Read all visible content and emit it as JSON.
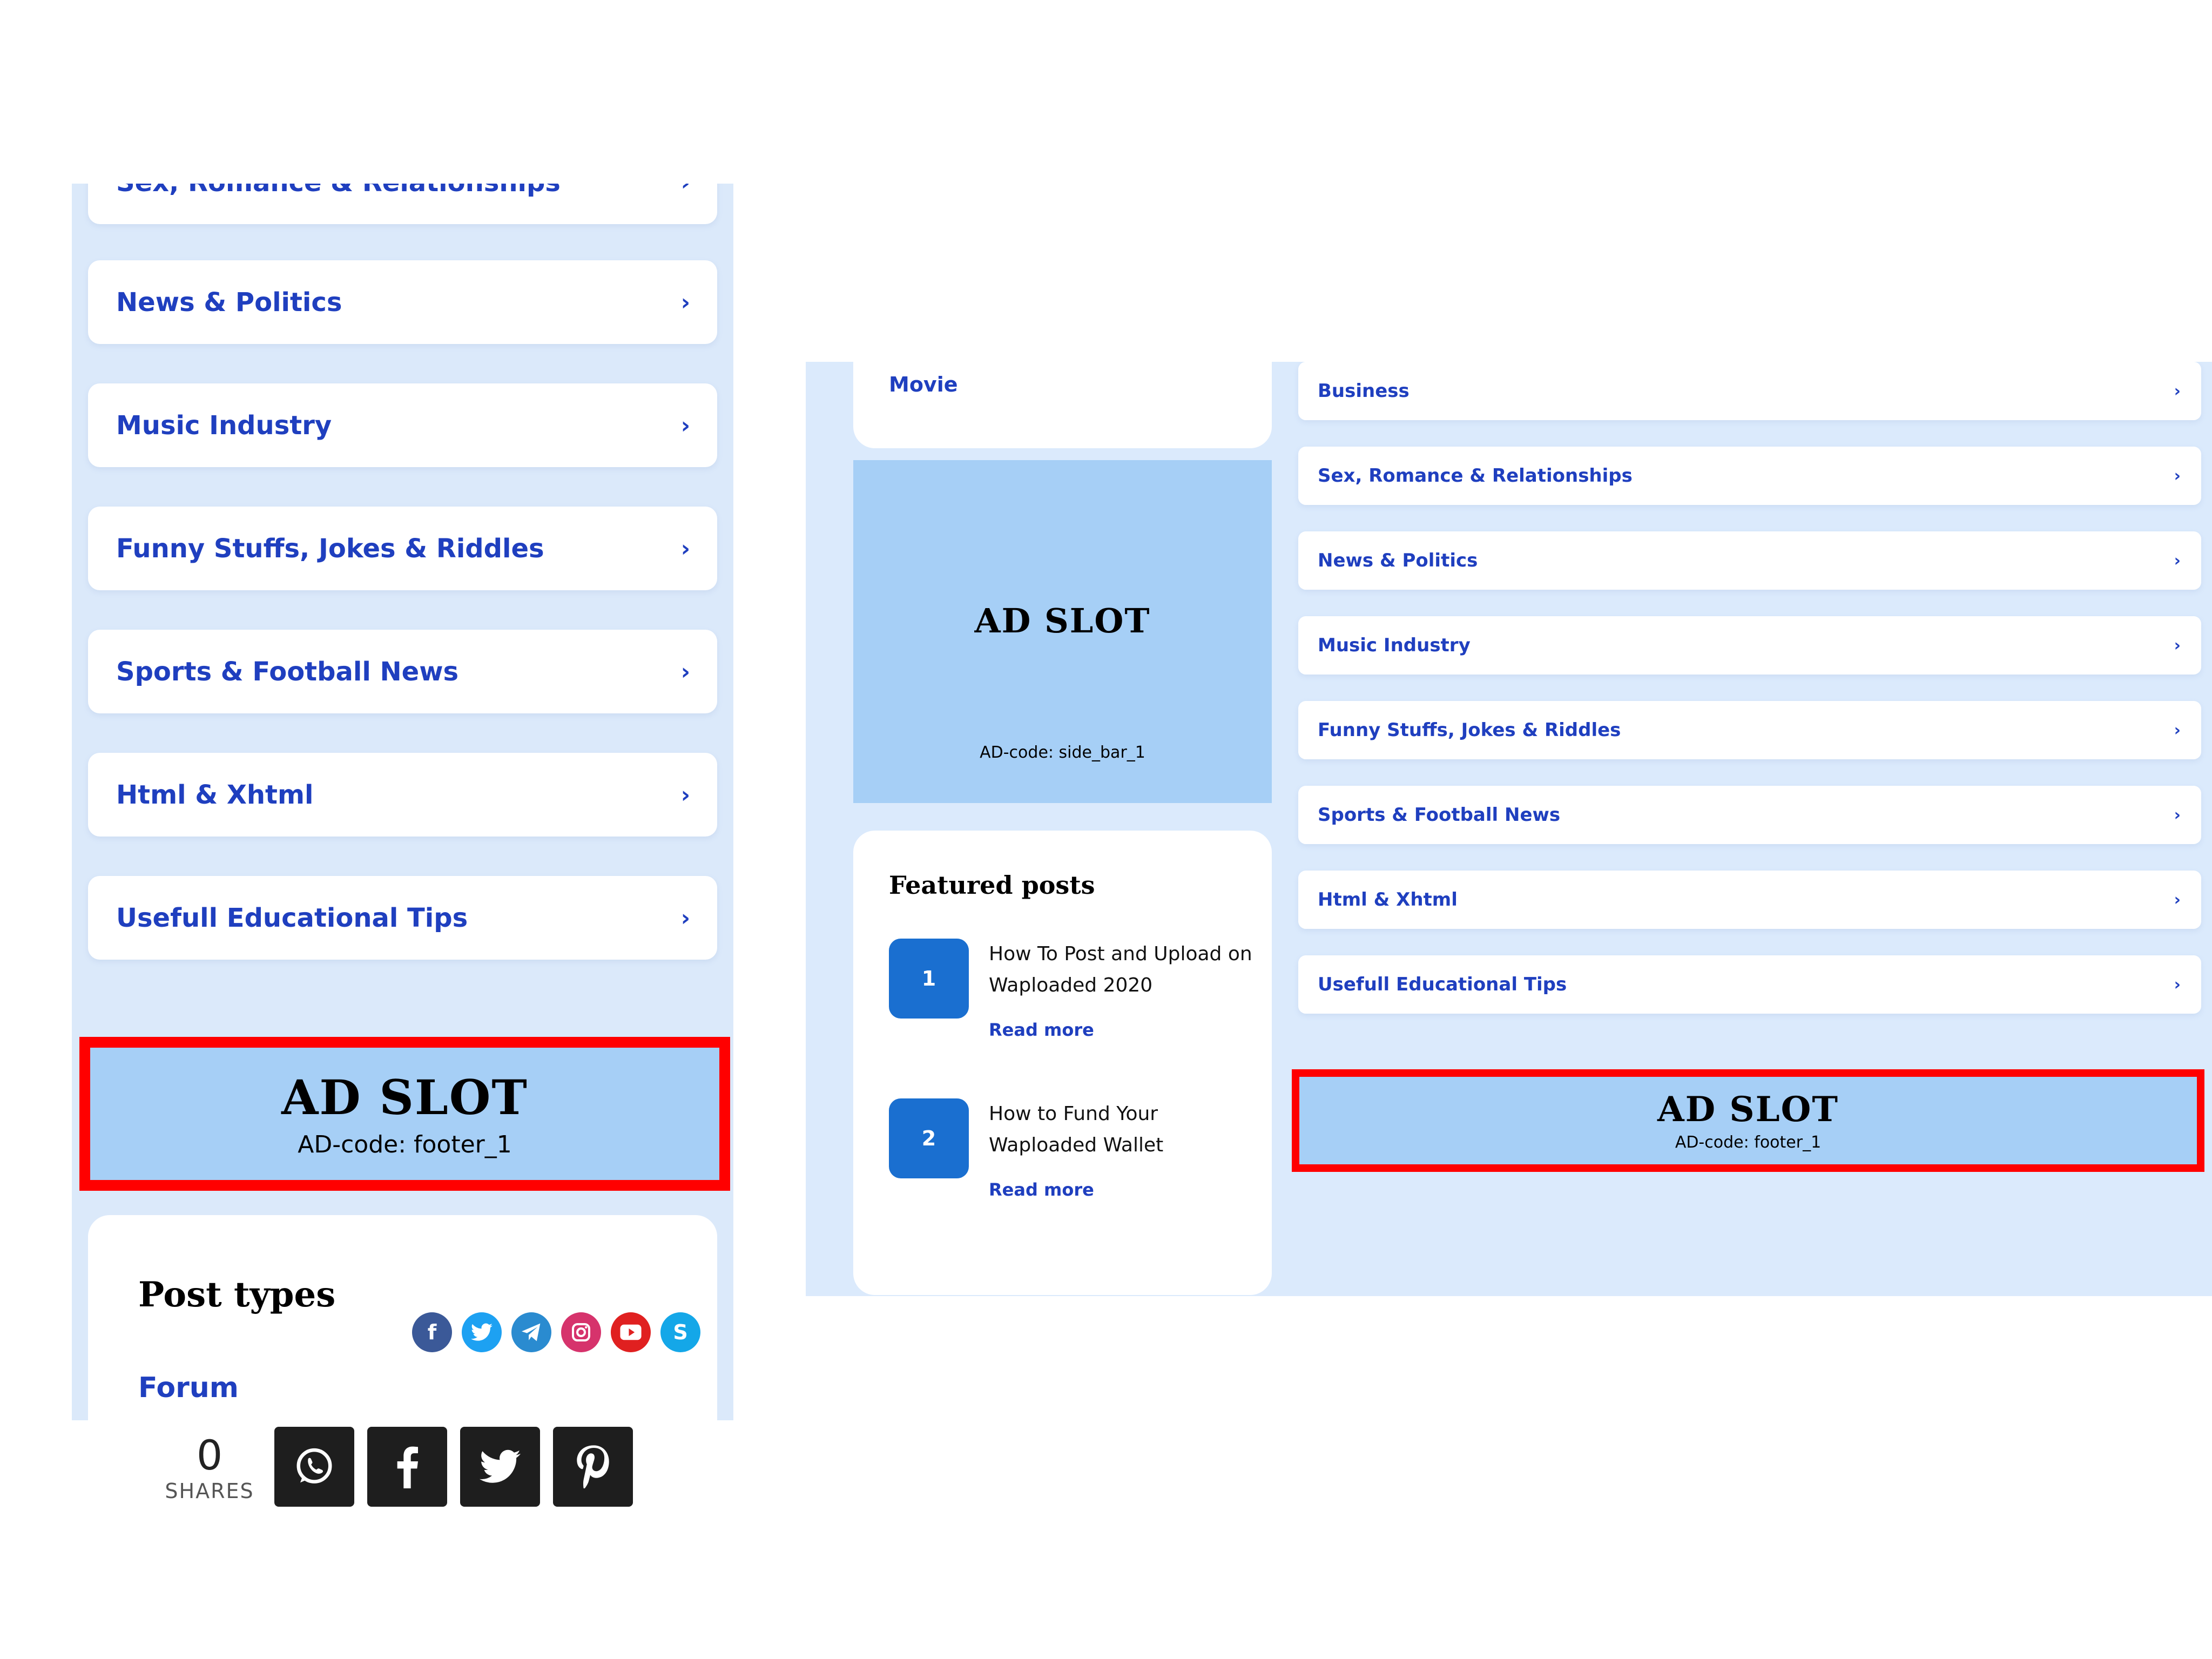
{
  "left": {
    "top_partial_item": "Sex, Romance & Relationships",
    "categories": [
      "News & Politics",
      "Music Industry",
      "Funny Stuffs, Jokes & Riddles",
      "Sports & Football News",
      "Html & Xhtml",
      "Usefull Educational Tips"
    ],
    "chevron": "›",
    "ad_title": "AD SLOT",
    "ad_code": "AD-code: footer_1",
    "post_types_title": "Post types",
    "forum_link": "Forum",
    "social_icons": [
      "facebook-icon",
      "twitter-icon",
      "telegram-icon",
      "instagram-icon",
      "youtube-icon",
      "skype-icon"
    ],
    "share_count": "0",
    "share_label": "SHARES",
    "share_buttons": [
      "whatsapp-icon",
      "facebook-icon",
      "twitter-icon",
      "pinterest-icon"
    ]
  },
  "right": {
    "movie_label": "Movie",
    "side_ad_title": "AD SLOT",
    "side_ad_code": "AD-code: side_bar_1",
    "featured_title": "Featured posts",
    "featured_posts": [
      {
        "num": "1",
        "title": "How To Post and Upload on Waploaded 2020",
        "more": "Read more"
      },
      {
        "num": "2",
        "title": "How to Fund Your Waploaded Wallet",
        "more": "Read more"
      }
    ],
    "categories": [
      "Business",
      "Sex, Romance & Relationships",
      "News & Politics",
      "Music Industry",
      "Funny Stuffs, Jokes & Riddles",
      "Sports & Football News",
      "Html & Xhtml",
      "Usefull Educational Tips"
    ],
    "chevron": "›",
    "footer_ad_title": "AD SLOT",
    "footer_ad_code": "AD-code: footer_1"
  },
  "colors": {
    "accent_blue": "#1f3fbf",
    "panel_bg": "#dbe9fa",
    "ad_bg": "#a6cff6",
    "highlight_red": "#ff0000",
    "number_badge": "#1a6fd0"
  }
}
